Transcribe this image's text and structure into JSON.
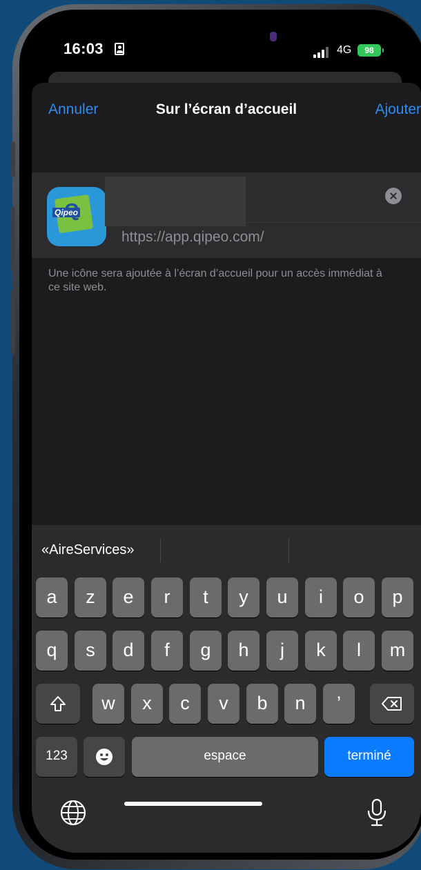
{
  "status_bar": {
    "time": "16:03",
    "network": "4G",
    "battery": "98"
  },
  "nav": {
    "cancel_label": "Annuler",
    "title": "Sur l’écran d’accueil",
    "add_label": "Ajouter"
  },
  "form": {
    "app_icon_label": "Qipeo",
    "name_value": "",
    "url": "https://app.qipeo.com/",
    "info": "Une icône sera ajoutée à l’écran d’accueil pour un accès immédiat à ce site web."
  },
  "keyboard": {
    "suggestions": [
      "«AireServices»",
      "",
      ""
    ],
    "row1": [
      "a",
      "z",
      "e",
      "r",
      "t",
      "y",
      "u",
      "i",
      "o",
      "p"
    ],
    "row2": [
      "q",
      "s",
      "d",
      "f",
      "g",
      "h",
      "j",
      "k",
      "l",
      "m"
    ],
    "row3": [
      "w",
      "x",
      "c",
      "v",
      "b",
      "n",
      "’"
    ],
    "numbers_label": "123",
    "space_label": "espace",
    "done_label": "terminé"
  },
  "colors": {
    "accent": "#2f8bf6",
    "done_key": "#0b7bff",
    "battery": "#33c759",
    "background": "#114a78"
  }
}
